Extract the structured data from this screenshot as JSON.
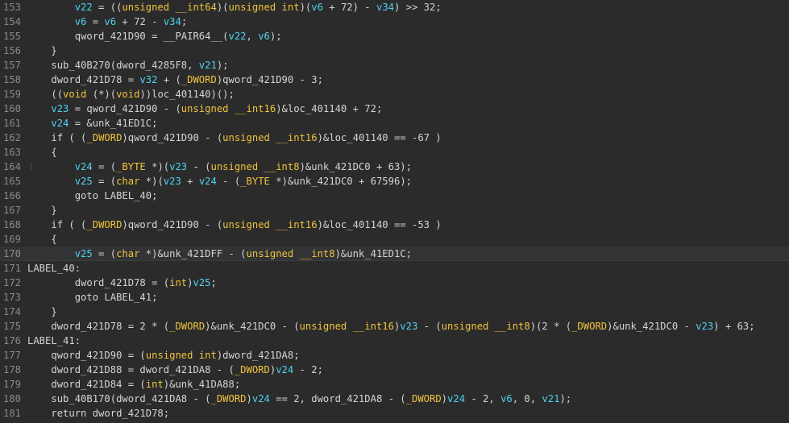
{
  "editor": {
    "colors": {
      "background": "#2b2b2b",
      "line_number": "#8a8a8a",
      "plain": "#d4d4d4",
      "variable": "#4dd2f0",
      "type": "#f0c43c",
      "current_line": "#313335"
    },
    "current_line": 170,
    "lines": [
      {
        "n": "153",
        "indent": 8,
        "tokens": [
          [
            "var",
            "v22"
          ],
          [
            "plain",
            " = (("
          ],
          [
            "type",
            "unsigned __int64"
          ],
          [
            "plain",
            ")("
          ],
          [
            "type",
            "unsigned int"
          ],
          [
            "plain",
            ")("
          ],
          [
            "var",
            "v6"
          ],
          [
            "plain",
            " + 72) - "
          ],
          [
            "var",
            "v34"
          ],
          [
            "plain",
            ") >> 32;"
          ]
        ]
      },
      {
        "n": "154",
        "indent": 8,
        "tokens": [
          [
            "var",
            "v6"
          ],
          [
            "plain",
            " = "
          ],
          [
            "var",
            "v6"
          ],
          [
            "plain",
            " + 72 - "
          ],
          [
            "var",
            "v34"
          ],
          [
            "plain",
            ";"
          ]
        ]
      },
      {
        "n": "155",
        "indent": 8,
        "tokens": [
          [
            "plain",
            "qword_421D90 = __PAIR64__("
          ],
          [
            "var",
            "v22"
          ],
          [
            "plain",
            ", "
          ],
          [
            "var",
            "v6"
          ],
          [
            "plain",
            ");"
          ]
        ]
      },
      {
        "n": "156",
        "indent": 4,
        "tokens": [
          [
            "plain",
            "}"
          ]
        ]
      },
      {
        "n": "157",
        "indent": 4,
        "tokens": [
          [
            "plain",
            "sub_40B270(dword_4285F8, "
          ],
          [
            "var",
            "v21"
          ],
          [
            "plain",
            ");"
          ]
        ]
      },
      {
        "n": "158",
        "indent": 4,
        "tokens": [
          [
            "plain",
            "dword_421D78 = "
          ],
          [
            "var",
            "v32"
          ],
          [
            "plain",
            " + ("
          ],
          [
            "type",
            "_DWORD"
          ],
          [
            "plain",
            ")qword_421D90 - 3;"
          ]
        ]
      },
      {
        "n": "159",
        "indent": 4,
        "tokens": [
          [
            "plain",
            "(("
          ],
          [
            "type",
            "void"
          ],
          [
            "plain",
            " (*)("
          ],
          [
            "type",
            "void"
          ],
          [
            "plain",
            "))loc_401140)();"
          ]
        ]
      },
      {
        "n": "160",
        "indent": 4,
        "tokens": [
          [
            "var",
            "v23"
          ],
          [
            "plain",
            " = qword_421D90 - ("
          ],
          [
            "type",
            "unsigned __int16"
          ],
          [
            "plain",
            ")&loc_401140 + 72;"
          ]
        ]
      },
      {
        "n": "161",
        "indent": 4,
        "tokens": [
          [
            "var",
            "v24"
          ],
          [
            "plain",
            " = &unk_41ED1C;"
          ]
        ]
      },
      {
        "n": "162",
        "indent": 4,
        "tokens": [
          [
            "plain",
            "if ( ("
          ],
          [
            "type",
            "_DWORD"
          ],
          [
            "plain",
            ")qword_421D90 - ("
          ],
          [
            "type",
            "unsigned __int16"
          ],
          [
            "plain",
            ")&loc_401140 == -67 )"
          ]
        ]
      },
      {
        "n": "163",
        "indent": 4,
        "tokens": [
          [
            "plain",
            "{"
          ]
        ]
      },
      {
        "n": "164",
        "indent": 8,
        "tokens": [
          [
            "var",
            "v24"
          ],
          [
            "plain",
            " = ("
          ],
          [
            "type",
            "_BYTE"
          ],
          [
            "plain",
            " *)("
          ],
          [
            "var",
            "v23"
          ],
          [
            "plain",
            " - ("
          ],
          [
            "type",
            "unsigned __int8"
          ],
          [
            "plain",
            ")&unk_421DC0 + 63);"
          ]
        ]
      },
      {
        "n": "165",
        "indent": 8,
        "tokens": [
          [
            "var",
            "v25"
          ],
          [
            "plain",
            " = ("
          ],
          [
            "type",
            "char"
          ],
          [
            "plain",
            " *)("
          ],
          [
            "var",
            "v23"
          ],
          [
            "plain",
            " + "
          ],
          [
            "var",
            "v24"
          ],
          [
            "plain",
            " - ("
          ],
          [
            "type",
            "_BYTE"
          ],
          [
            "plain",
            " *)&unk_421DC0 + 67596);"
          ]
        ]
      },
      {
        "n": "166",
        "indent": 8,
        "tokens": [
          [
            "plain",
            "goto LABEL_40;"
          ]
        ]
      },
      {
        "n": "167",
        "indent": 4,
        "tokens": [
          [
            "plain",
            "}"
          ]
        ]
      },
      {
        "n": "168",
        "indent": 4,
        "tokens": [
          [
            "plain",
            "if ( ("
          ],
          [
            "type",
            "_DWORD"
          ],
          [
            "plain",
            ")qword_421D90 - ("
          ],
          [
            "type",
            "unsigned __int16"
          ],
          [
            "plain",
            ")&loc_401140 == -53 )"
          ]
        ]
      },
      {
        "n": "169",
        "indent": 4,
        "tokens": [
          [
            "plain",
            "{"
          ]
        ]
      },
      {
        "n": "170",
        "indent": 8,
        "tokens": [
          [
            "var",
            "v25"
          ],
          [
            "plain",
            " = ("
          ],
          [
            "type",
            "char"
          ],
          [
            "plain",
            " *)&unk_421DFF - ("
          ],
          [
            "type",
            "unsigned __int8"
          ],
          [
            "plain",
            ")&unk_41ED1C;"
          ]
        ]
      },
      {
        "n": "171",
        "indent": 0,
        "tokens": [
          [
            "plain",
            "LABEL_40:"
          ]
        ]
      },
      {
        "n": "172",
        "indent": 8,
        "tokens": [
          [
            "plain",
            "dword_421D78 = ("
          ],
          [
            "type",
            "int"
          ],
          [
            "plain",
            ")"
          ],
          [
            "var",
            "v25"
          ],
          [
            "plain",
            ";"
          ]
        ]
      },
      {
        "n": "173",
        "indent": 8,
        "tokens": [
          [
            "plain",
            "goto LABEL_41;"
          ]
        ]
      },
      {
        "n": "174",
        "indent": 4,
        "tokens": [
          [
            "plain",
            "}"
          ]
        ]
      },
      {
        "n": "175",
        "indent": 4,
        "tokens": [
          [
            "plain",
            "dword_421D78 = 2 * ("
          ],
          [
            "type",
            "_DWORD"
          ],
          [
            "plain",
            ")&unk_421DC0 - ("
          ],
          [
            "type",
            "unsigned __int16"
          ],
          [
            "plain",
            ")"
          ],
          [
            "var",
            "v23"
          ],
          [
            "plain",
            " - ("
          ],
          [
            "type",
            "unsigned __int8"
          ],
          [
            "plain",
            ")(2 * ("
          ],
          [
            "type",
            "_DWORD"
          ],
          [
            "plain",
            ")&unk_421DC0 - "
          ],
          [
            "var",
            "v23"
          ],
          [
            "plain",
            ") + 63;"
          ]
        ]
      },
      {
        "n": "176",
        "indent": 0,
        "tokens": [
          [
            "plain",
            "LABEL_41:"
          ]
        ]
      },
      {
        "n": "177",
        "indent": 4,
        "tokens": [
          [
            "plain",
            "qword_421D90 = ("
          ],
          [
            "type",
            "unsigned int"
          ],
          [
            "plain",
            ")dword_421DA8;"
          ]
        ]
      },
      {
        "n": "178",
        "indent": 4,
        "tokens": [
          [
            "plain",
            "dword_421D88 = dword_421DA8 - ("
          ],
          [
            "type",
            "_DWORD"
          ],
          [
            "plain",
            ")"
          ],
          [
            "var",
            "v24"
          ],
          [
            "plain",
            " - 2;"
          ]
        ]
      },
      {
        "n": "179",
        "indent": 4,
        "tokens": [
          [
            "plain",
            "dword_421D84 = ("
          ],
          [
            "type",
            "int"
          ],
          [
            "plain",
            ")&unk_41DA88;"
          ]
        ]
      },
      {
        "n": "180",
        "indent": 4,
        "tokens": [
          [
            "plain",
            "sub_40B170(dword_421DA8 - ("
          ],
          [
            "type",
            "_DWORD"
          ],
          [
            "plain",
            ")"
          ],
          [
            "var",
            "v24"
          ],
          [
            "plain",
            " == 2, dword_421DA8 - ("
          ],
          [
            "type",
            "_DWORD"
          ],
          [
            "plain",
            ")"
          ],
          [
            "var",
            "v24"
          ],
          [
            "plain",
            " - 2, "
          ],
          [
            "var",
            "v6"
          ],
          [
            "plain",
            ", 0, "
          ],
          [
            "var",
            "v21"
          ],
          [
            "plain",
            ");"
          ]
        ]
      },
      {
        "n": "181",
        "indent": 4,
        "tokens": [
          [
            "plain",
            "return dword_421D78;"
          ]
        ]
      }
    ]
  }
}
